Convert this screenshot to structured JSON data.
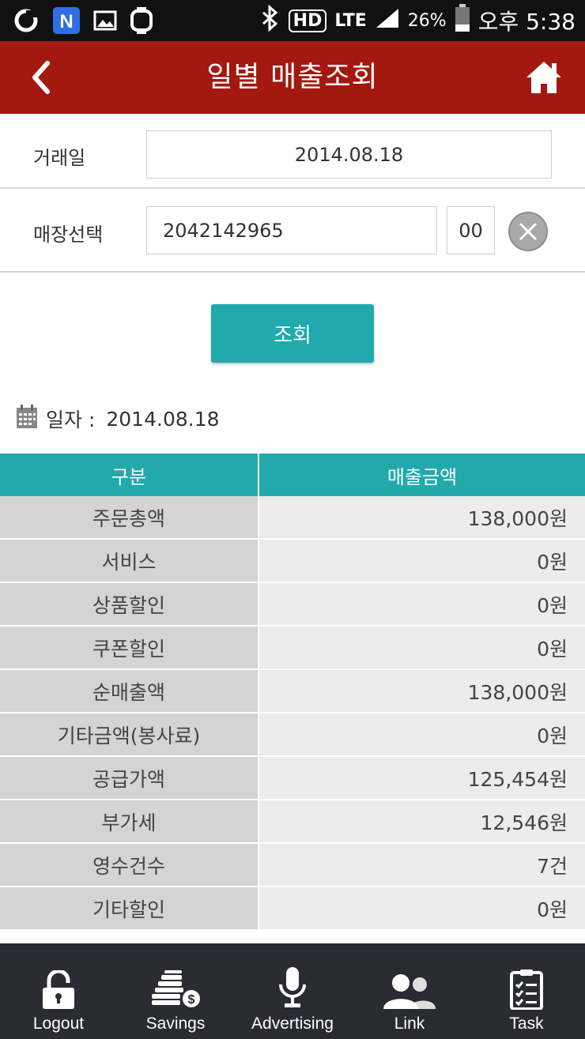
{
  "status_bar": {
    "battery": "26%",
    "network": "LTE",
    "hd": "HD",
    "time": "오후 5:38"
  },
  "header": {
    "title": "일별 매출조회",
    "back_icon": "chevron-left-icon",
    "home_icon": "home-icon"
  },
  "form": {
    "trade_date_label": "거래일",
    "trade_date_value": "2014.08.18",
    "store_label": "매장선택",
    "store_value": "2042142965",
    "store_code": "00",
    "query_button": "조회"
  },
  "result": {
    "date_label": "일자 :",
    "date_value": "2014.08.18",
    "columns": [
      "구분",
      "매출금액"
    ],
    "rows": [
      {
        "label": "주문총액",
        "value": "138,000원"
      },
      {
        "label": "서비스",
        "value": "0원"
      },
      {
        "label": "상품할인",
        "value": "0원"
      },
      {
        "label": "쿠폰할인",
        "value": "0원"
      },
      {
        "label": "순매출액",
        "value": "138,000원"
      },
      {
        "label": "기타금액(봉사료)",
        "value": "0원"
      },
      {
        "label": "공급가액",
        "value": "125,454원"
      },
      {
        "label": "부가세",
        "value": "12,546원"
      },
      {
        "label": "영수건수",
        "value": "7건"
      },
      {
        "label": "기타할인",
        "value": "0원"
      }
    ]
  },
  "tabbar": {
    "items": [
      {
        "label": "Logout",
        "icon": "unlock-icon"
      },
      {
        "label": "Savings",
        "icon": "coins-icon"
      },
      {
        "label": "Advertising",
        "icon": "microphone-icon"
      },
      {
        "label": "Link",
        "icon": "users-icon"
      },
      {
        "label": "Task",
        "icon": "clipboard-check-icon"
      }
    ]
  },
  "colors": {
    "header": "#a3180f",
    "accent": "#20aaad",
    "tabbar": "#2a2b33"
  }
}
